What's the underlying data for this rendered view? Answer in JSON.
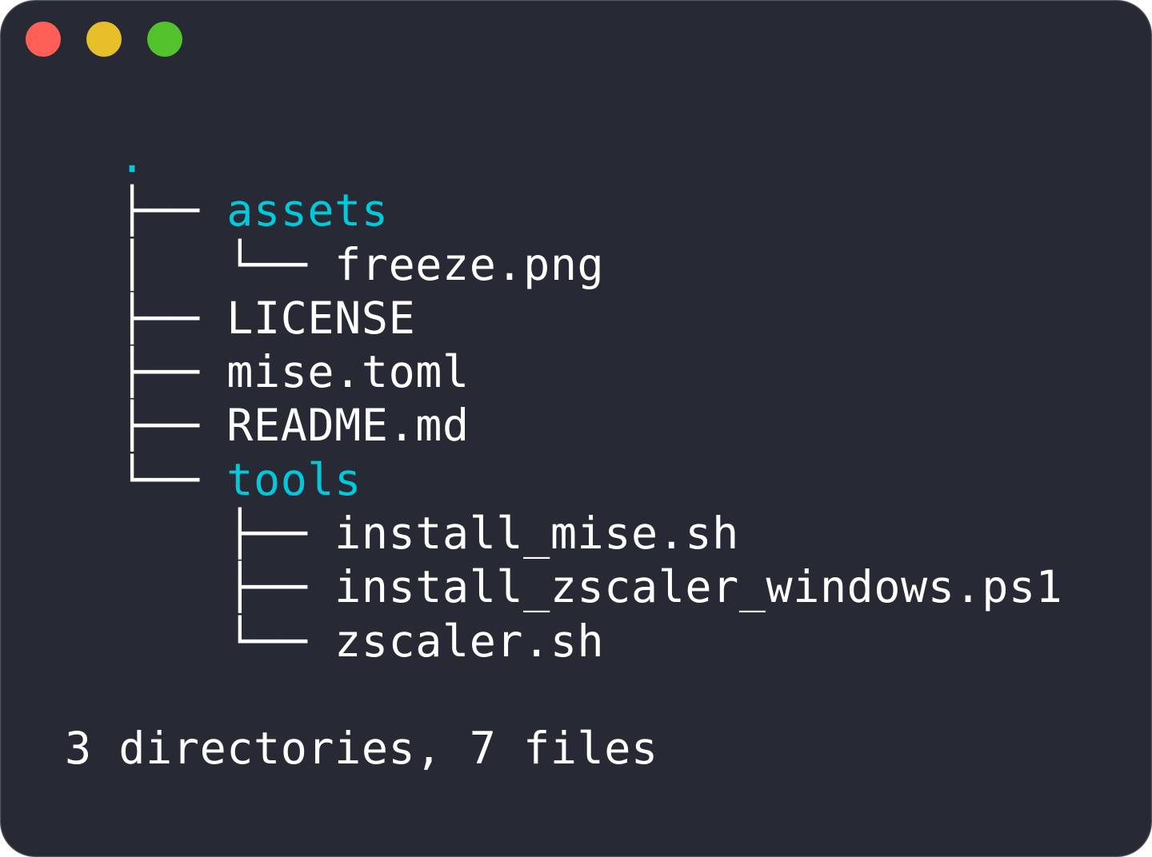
{
  "window": {
    "controls": [
      {
        "name": "close",
        "color": "#fe5f57"
      },
      {
        "name": "minimize",
        "color": "#e6bf2a"
      },
      {
        "name": "maximize",
        "color": "#52c22d"
      }
    ],
    "background": "#272a35",
    "directory_color": "#00c9dc",
    "text_color": "#ffffff"
  },
  "tree": {
    "root": ".",
    "lines": [
      {
        "prefix": "├── ",
        "name": "assets",
        "type": "directory"
      },
      {
        "prefix": "│   └── ",
        "name": "freeze.png",
        "type": "file"
      },
      {
        "prefix": "├── ",
        "name": "LICENSE",
        "type": "file"
      },
      {
        "prefix": "├── ",
        "name": "mise.toml",
        "type": "file"
      },
      {
        "prefix": "├── ",
        "name": "README.md",
        "type": "file"
      },
      {
        "prefix": "└── ",
        "name": "tools",
        "type": "directory"
      },
      {
        "prefix": "    ├── ",
        "name": "install_mise.sh",
        "type": "file"
      },
      {
        "prefix": "    ├── ",
        "name": "install_zscaler_windows.ps1",
        "type": "file"
      },
      {
        "prefix": "    └── ",
        "name": "zscaler.sh",
        "type": "file"
      }
    ],
    "summary": "3 directories, 7 files"
  }
}
